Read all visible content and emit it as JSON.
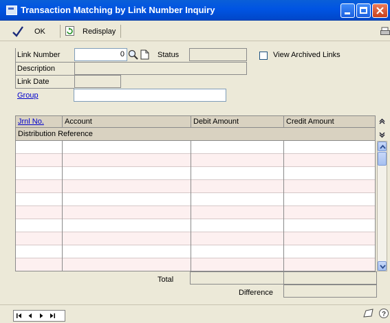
{
  "window": {
    "title": "Transaction Matching by Link Number Inquiry"
  },
  "toolbar": {
    "ok_label": "OK",
    "redisplay_label": "Redisplay"
  },
  "form": {
    "link_number_label": "Link Number",
    "link_number_value": "0",
    "status_label": "Status",
    "status_value": "",
    "view_archived_label": "View Archived Links",
    "view_archived_checked": false,
    "description_label": "Description",
    "description_value": "",
    "link_date_label": "Link Date",
    "link_date_value": "",
    "group_label": "Group",
    "group_value": ""
  },
  "grid": {
    "columns": [
      "Jrnl No.",
      "Account",
      "Debit Amount",
      "Credit Amount"
    ],
    "second_header": "Distribution Reference",
    "rows": [
      {
        "jrnl": "",
        "account": "",
        "debit": "",
        "credit": ""
      },
      {
        "jrnl": "",
        "account": "",
        "debit": "",
        "credit": ""
      },
      {
        "jrnl": "",
        "account": "",
        "debit": "",
        "credit": ""
      },
      {
        "jrnl": "",
        "account": "",
        "debit": "",
        "credit": ""
      },
      {
        "jrnl": "",
        "account": "",
        "debit": "",
        "credit": ""
      },
      {
        "jrnl": "",
        "account": "",
        "debit": "",
        "credit": ""
      },
      {
        "jrnl": "",
        "account": "",
        "debit": "",
        "credit": ""
      },
      {
        "jrnl": "",
        "account": "",
        "debit": "",
        "credit": ""
      },
      {
        "jrnl": "",
        "account": "",
        "debit": "",
        "credit": ""
      },
      {
        "jrnl": "",
        "account": "",
        "debit": "",
        "credit": ""
      }
    ]
  },
  "totals": {
    "total_label": "Total",
    "total_debit": "",
    "total_credit": "",
    "difference_label": "Difference",
    "difference_value": ""
  },
  "icons": {
    "ok": "checkmark-icon",
    "redisplay": "refresh-icon",
    "lookup": "lookup-icon",
    "note": "note-icon",
    "print": "print-icon",
    "help": "help-icon",
    "expand": "expand-rows-icon",
    "collapse": "collapse-rows-icon"
  },
  "colors": {
    "title_bar": "#0054e3",
    "window_bg": "#ece9d8",
    "link": "#0000cc",
    "row_alt": "#fdf0f0"
  }
}
